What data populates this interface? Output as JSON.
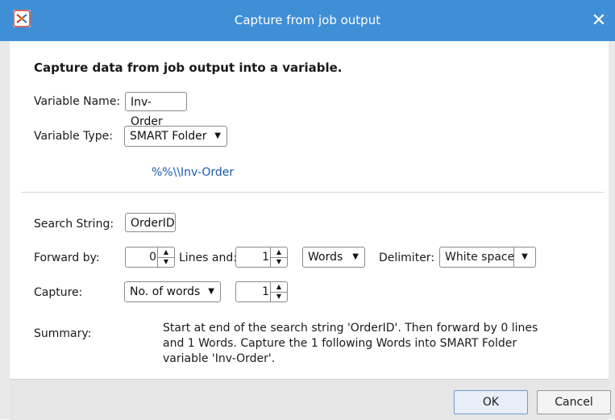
{
  "window": {
    "title": "Capture from job output",
    "close_glyph": "✕"
  },
  "form": {
    "heading": "Capture data from job output into a variable.",
    "variable_name_label": "Variable Name:",
    "variable_name_value": "Inv-Order",
    "variable_type_label": "Variable Type:",
    "variable_type_value": "SMART Folder",
    "variable_preview": "%%\\\\Inv-Order",
    "search_string_label": "Search String:",
    "search_string_value": "OrderID",
    "forward_by_label": "Forward by:",
    "forward_lines_value": "0",
    "lines_and_label": "Lines and:",
    "forward_units_value": "1",
    "unit_type_value": "Words",
    "delimiter_label": "Delimiter:",
    "delimiter_value": "White space",
    "capture_label": "Capture:",
    "capture_mode_value": "No. of words",
    "capture_count_value": "1",
    "summary_label": "Summary:",
    "summary_text": "Start at end of the search string 'OrderID'. Then forward by 0 lines and 1 Words. Capture the 1 following Words into SMART Folder variable 'Inv-Order'."
  },
  "footer": {
    "ok_label": "OK",
    "cancel_label": "Cancel"
  },
  "icons": {
    "dropdown": "chevron-down-icon",
    "spin_up": "spin-up-icon",
    "spin_down": "spin-down-icon"
  },
  "colors": {
    "titlebar": "#3f8fd6",
    "link": "#1a5aa6"
  }
}
